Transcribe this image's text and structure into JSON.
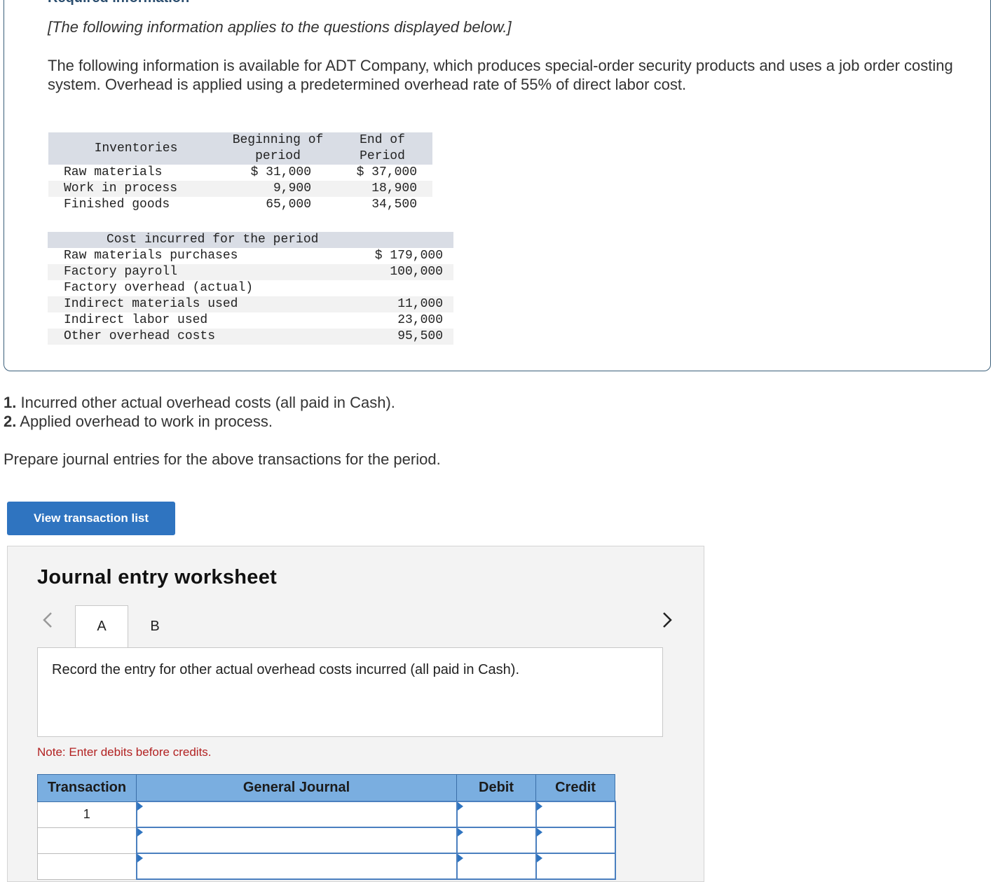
{
  "header": {
    "required_title": "Required information",
    "applies_note": "[The following information applies to the questions displayed below.]",
    "intro": "The following information is available for ADT Company, which produces special-order security products and uses a job order costing system. Overhead is applied using a predetermined overhead rate of 55% of direct labor cost."
  },
  "inventories": {
    "col_label": "Inventories",
    "col_begin": "Beginning of period",
    "col_end": "End of Period",
    "rows": [
      {
        "label": "Raw materials",
        "begin": "$ 31,000",
        "end": "$ 37,000"
      },
      {
        "label": "Work in process",
        "begin": "9,900",
        "end": "18,900"
      },
      {
        "label": "Finished goods",
        "begin": "65,000",
        "end": "34,500"
      }
    ]
  },
  "costs": {
    "title": "Cost incurred for the period",
    "rows": [
      {
        "label": "Raw materials purchases",
        "value": "$ 179,000"
      },
      {
        "label": "Factory payroll",
        "value": "100,000"
      },
      {
        "label": "Factory overhead (actual)",
        "value": ""
      },
      {
        "label": "Indirect materials used",
        "value": "11,000"
      },
      {
        "label": "Indirect labor used",
        "value": "23,000"
      },
      {
        "label": "Other overhead costs",
        "value": "95,500"
      }
    ]
  },
  "questions": [
    {
      "num": "1.",
      "text": "Incurred other actual overhead costs (all paid in Cash)."
    },
    {
      "num": "2.",
      "text": "Applied overhead to work in process."
    }
  ],
  "prepare_text": "Prepare journal entries for the above transactions for the period.",
  "view_button_label": "View transaction list",
  "worksheet": {
    "title": "Journal entry worksheet",
    "tabs": [
      "A",
      "B"
    ],
    "active_tab": "A",
    "prompt": "Record the entry for other actual overhead costs incurred (all paid in Cash).",
    "note": "Note: Enter debits before credits.",
    "columns": [
      "Transaction",
      "General Journal",
      "Debit",
      "Credit"
    ],
    "rows": [
      {
        "transaction": "1",
        "account": "",
        "debit": "",
        "credit": ""
      },
      {
        "transaction": "",
        "account": "",
        "debit": "",
        "credit": ""
      },
      {
        "transaction": "",
        "account": "",
        "debit": "",
        "credit": ""
      }
    ]
  },
  "colors": {
    "accent": "#2f74c0",
    "table_header": "#7aaee0",
    "note": "#b22222"
  }
}
